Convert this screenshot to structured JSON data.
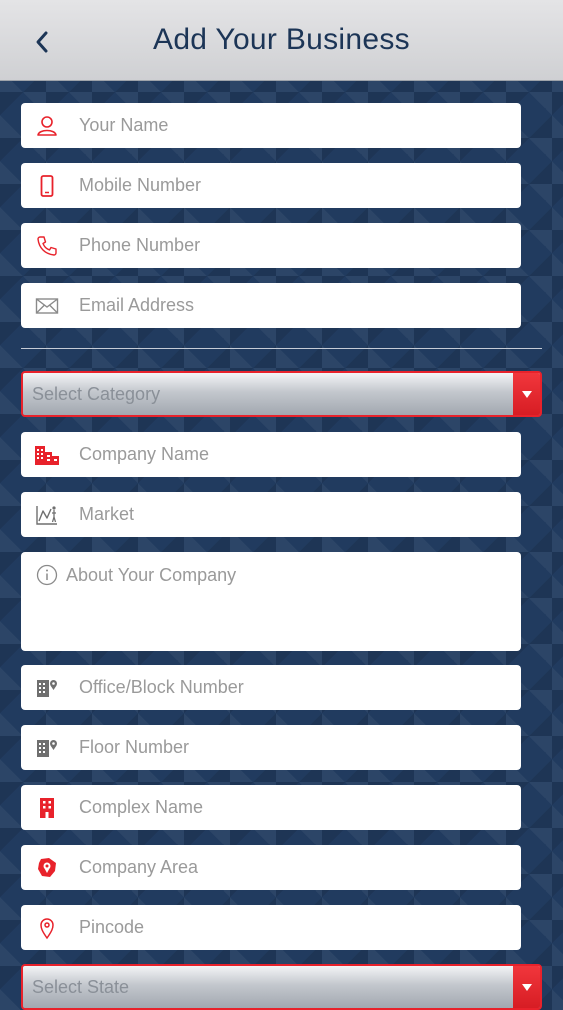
{
  "header": {
    "title": "Add Your Business",
    "back_icon": "chevron-left-icon"
  },
  "form": {
    "your_name": "Your Name",
    "mobile_number": "Mobile Number",
    "phone_number": "Phone Number",
    "email_address": "Email Address",
    "select_category": "Select Category",
    "company_name": "Company Name",
    "market": "Market",
    "about_company": "About Your Company",
    "office_block_number": "Office/Block Number",
    "floor_number": "Floor Number",
    "complex_name": "Complex Name",
    "company_area": "Company Area",
    "pincode": "Pincode",
    "select_state": "Select State"
  },
  "colors": {
    "header_bg": "#d9d9dc",
    "header_text": "#1c3556",
    "background": "#213b5f",
    "accent_red": "#e8222b",
    "icon_red": "#e8222b",
    "icon_gray": "#8a8a8a",
    "placeholder": "#9a9a9a"
  }
}
